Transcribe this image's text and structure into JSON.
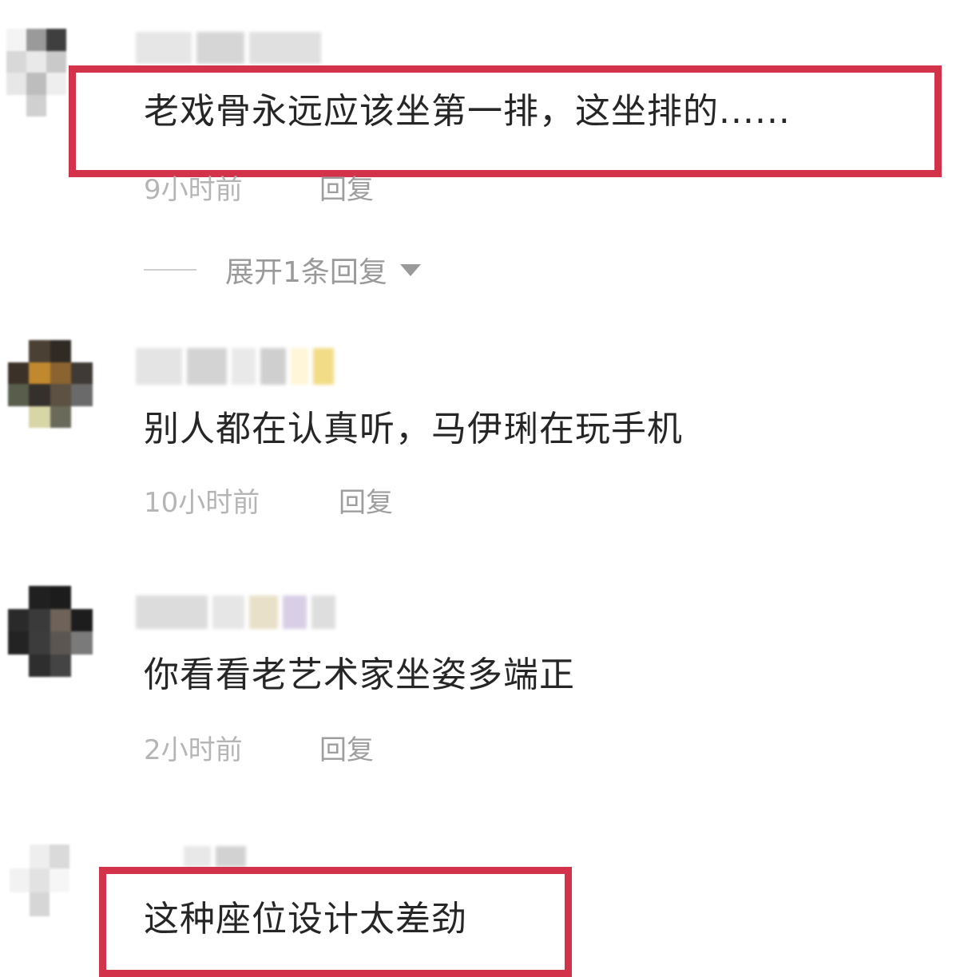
{
  "comments": [
    {
      "text": "老戏骨永远应该坐第一排，这坐排的......",
      "time": "9小时前",
      "reply": "回复",
      "expand_replies": "展开1条回复"
    },
    {
      "text": "别人都在认真听，马伊琍在玩手机",
      "time": "10小时前",
      "reply": "回复"
    },
    {
      "text": "你看看老艺术家坐姿多端正",
      "time": "2小时前",
      "reply": "回复"
    },
    {
      "text": "这种座位设计太差劲"
    }
  ],
  "colors": {
    "highlight": "#d2334a",
    "meta_text": "#b5b5b5",
    "body_text": "#262626"
  },
  "icons": {
    "expand": "caret-down-icon"
  }
}
